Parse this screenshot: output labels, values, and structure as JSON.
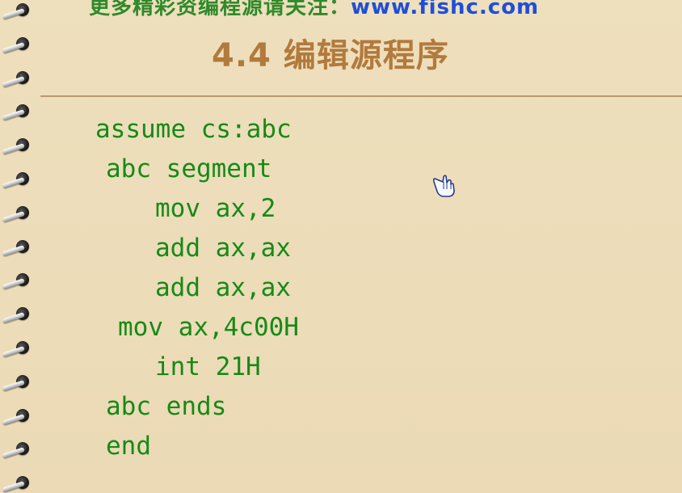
{
  "banner": {
    "text": "更多精彩资编程源请关注：",
    "url": "www.fishc.com"
  },
  "slide": {
    "title": "4.4 编辑源程序"
  },
  "code": {
    "lines": [
      "assume cs:abc",
      "abc segment",
      "mov ax,2",
      "add ax,ax",
      "add ax,ax",
      "mov ax,4c00H",
      "int 21H",
      "abc ends",
      "end"
    ]
  },
  "colors": {
    "background": "#ecdcb8",
    "title": "#b27a3c",
    "code": "#168a16",
    "banner_text": "#2f8a2a",
    "banner_url": "#1f4fd8",
    "divider": "#b79a73"
  },
  "icons": {
    "binding": "spiral-binding-ring",
    "cursor": "hand-pointer-cursor"
  }
}
